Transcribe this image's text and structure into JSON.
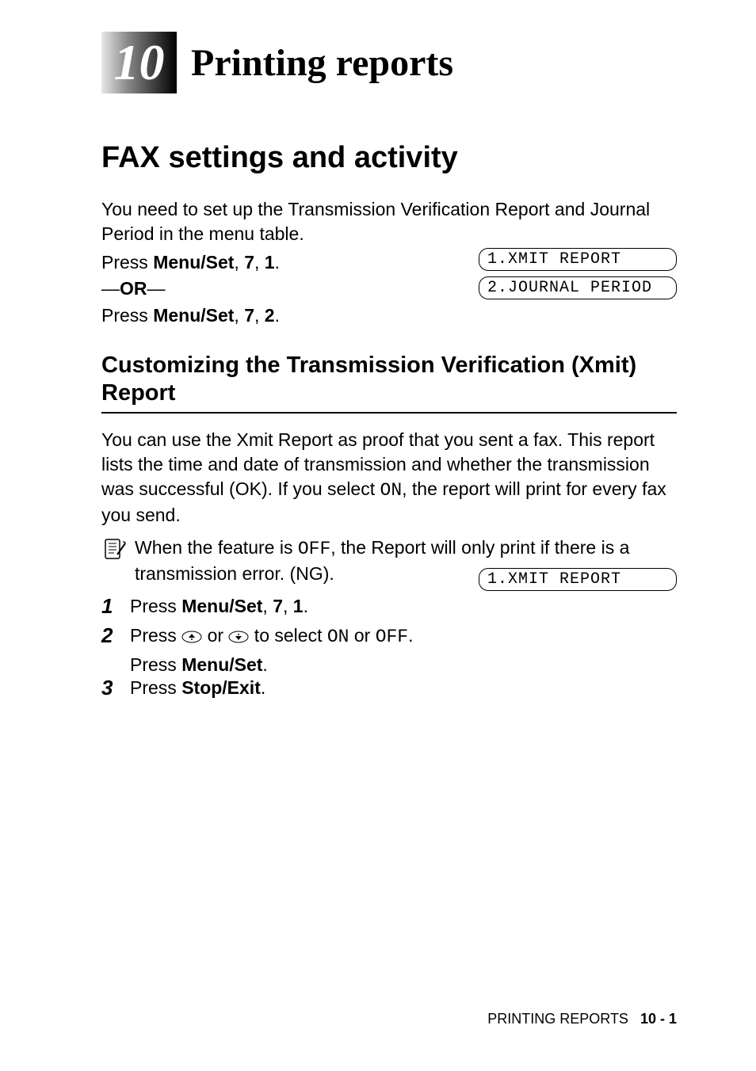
{
  "chapter": {
    "number": "10",
    "title": "Printing reports"
  },
  "section": {
    "heading": "FAX settings and activity",
    "intro": "You need to set up the Transmission Verification Report and Journal Period in the menu table.",
    "press1_prefix": "Press ",
    "press1_key": "Menu/Set",
    "press1_sep1": ", ",
    "press1_k2": "7",
    "press1_sep2": ", ",
    "press1_k3": "1",
    "press1_end": ".",
    "or_dash1": "—",
    "or_text": "OR",
    "or_dash2": "—",
    "press2_prefix": "Press ",
    "press2_key": "Menu/Set",
    "press2_sep1": ", ",
    "press2_k2": "7",
    "press2_sep2": ", ",
    "press2_k3": "2",
    "press2_end": "."
  },
  "lcd": {
    "xmit": "1.XMIT REPORT",
    "journal": "2.JOURNAL PERIOD",
    "xmit2": "1.XMIT REPORT"
  },
  "subsection": {
    "heading": "Customizing the Transmission Verification (Xmit) Report",
    "body_p1a": "You can use the Xmit Report as proof that you sent a fax. This report lists the time and date of transmission and whether the transmission was successful (OK). If you select ",
    "body_on": "ON",
    "body_p1b": ", the report will print for every fax you send.",
    "note_a": "When the feature is ",
    "note_off": "OFF",
    "note_b": ", the Report will only print if there is a transmission error. (NG)."
  },
  "steps": {
    "s1_num": "1",
    "s1_prefix": "Press ",
    "s1_key": "Menu/Set",
    "s1_sep1": ", ",
    "s1_k2": "7",
    "s1_sep2": ", ",
    "s1_k3": "1",
    "s1_end": ".",
    "s2_num": "2",
    "s2_a": "Press ",
    "s2_b": " or ",
    "s2_c": " to select ",
    "s2_on": "ON",
    "s2_d": " or ",
    "s2_off": "OFF",
    "s2_e": ".",
    "s2_line2a": "Press ",
    "s2_line2b": "Menu/Set",
    "s2_line2c": ".",
    "s3_num": "3",
    "s3_a": "Press ",
    "s3_b": "Stop/Exit",
    "s3_c": "."
  },
  "footer": {
    "label": "PRINTING REPORTS",
    "page": "10 - 1"
  }
}
